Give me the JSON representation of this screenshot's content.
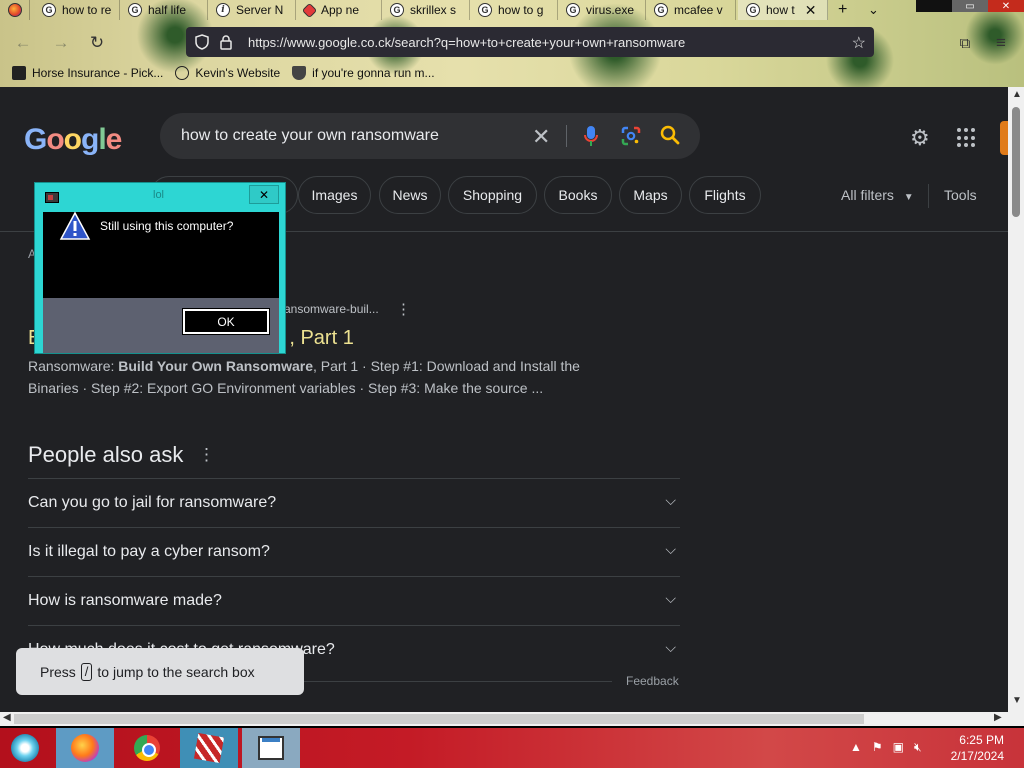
{
  "browser": {
    "tabs": [
      {
        "title": "how to re",
        "icon": "google-icon"
      },
      {
        "title": "half life",
        "icon": "google-icon"
      },
      {
        "title": "Server N",
        "icon": "info-icon"
      },
      {
        "title": "App ne",
        "icon": "app-icon"
      },
      {
        "title": "skrillex s",
        "icon": "google-icon"
      },
      {
        "title": "how to g",
        "icon": "google-icon"
      },
      {
        "title": "virus.exe",
        "icon": "google-icon"
      },
      {
        "title": "mcafee v",
        "icon": "google-icon"
      },
      {
        "title": "how t",
        "icon": "google-icon"
      }
    ],
    "new_tab_label": "+",
    "url": "https://www.google.co.ck/search?q=how+to+create+your+own+ransomware",
    "bookmarks": [
      {
        "label": "Horse Insurance - Pick...",
        "icon": "bookmark-icon"
      },
      {
        "label": "Kevin's Website",
        "icon": "globe-icon"
      },
      {
        "label": "if you're gonna run m...",
        "icon": "shield-icon"
      }
    ]
  },
  "google": {
    "logo": "Google",
    "logo_colors": [
      "#8ab4f8",
      "#f28b82",
      "#fdd663",
      "#8ab4f8",
      "#81c995",
      "#f28b82"
    ],
    "query": "how to create your own ransomware",
    "chips": [
      "Images",
      "News",
      "Shopping",
      "Books",
      "Maps",
      "Flights"
    ],
    "all_filters": "All filters",
    "tools": "Tools"
  },
  "result": {
    "about_prefix": "A",
    "cite": "ansomware-buil...",
    "title_visible": "E",
    "title_tail": ", Part 1",
    "snippet_pre": "Ransomware: ",
    "snippet_bold": "Build Your Own Ransomware",
    "snippet_post": ", Part 1 · Step #1: Download and Install the Binaries · Step #2: Export GO Environment variables · Step #3: Make the source ..."
  },
  "people_also_ask": {
    "title": "People also ask",
    "questions": [
      "Can you go to jail for ransomware?",
      "Is it illegal to pay a cyber ransom?",
      "How is ransomware made?",
      "How much does it cost to get ransomware?"
    ],
    "feedback": "Feedback"
  },
  "toast": {
    "pre": "Press",
    "key": "/",
    "post": "to jump to the search box"
  },
  "dialog": {
    "title": "lol",
    "message": "Still using this computer?",
    "ok_label": "OK",
    "close_label": "✕"
  },
  "taskbar": {
    "time": "6:25 PM",
    "date": "2/17/2024"
  },
  "colors": {
    "link_title": "#ede291",
    "dialog_frame": "#2dd6d3",
    "taskbar": "#c41b26"
  }
}
